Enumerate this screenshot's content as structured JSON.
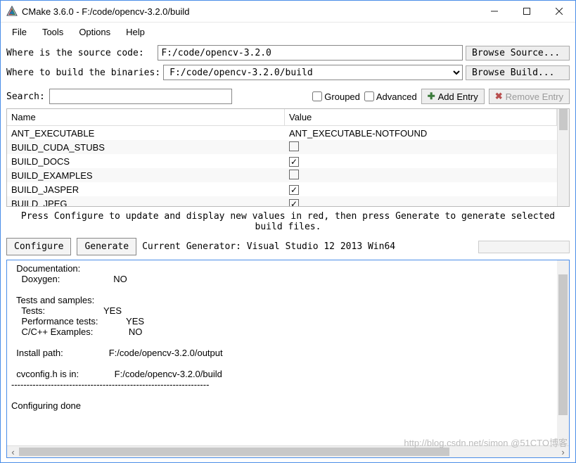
{
  "window": {
    "title": "CMake 3.6.0 - F:/code/opencv-3.2.0/build"
  },
  "menu": {
    "file": "File",
    "tools": "Tools",
    "options": "Options",
    "help": "Help"
  },
  "paths": {
    "source_label": "Where is the source code:  ",
    "source_value": "F:/code/opencv-3.2.0",
    "browse_source": "Browse Source...",
    "build_label": "Where to build the binaries:",
    "build_value": "F:/code/opencv-3.2.0/build",
    "browse_build": "Browse Build..."
  },
  "search": {
    "label": "Search:",
    "value": "",
    "grouped_label": "Grouped",
    "advanced_label": "Advanced",
    "add_entry": "Add Entry",
    "remove_entry": "Remove Entry"
  },
  "table": {
    "header_name": "Name",
    "header_value": "Value",
    "rows": [
      {
        "name": "ANT_EXECUTABLE",
        "value": "ANT_EXECUTABLE-NOTFOUND",
        "type": "text"
      },
      {
        "name": "BUILD_CUDA_STUBS",
        "value": false,
        "type": "bool"
      },
      {
        "name": "BUILD_DOCS",
        "value": true,
        "type": "bool"
      },
      {
        "name": "BUILD_EXAMPLES",
        "value": false,
        "type": "bool"
      },
      {
        "name": "BUILD_JASPER",
        "value": true,
        "type": "bool"
      },
      {
        "name": "BUILD_JPEG",
        "value": true,
        "type": "bool"
      }
    ]
  },
  "hint": "Press Configure to update and display new values in red, then press Generate to generate selected\nbuild files.",
  "actions": {
    "configure": "Configure",
    "generate": "Generate",
    "generator": "Current Generator: Visual Studio 12 2013 Win64"
  },
  "output_lines": [
    "  Documentation:",
    "    Doxygen:                     NO",
    "",
    "  Tests and samples:",
    "    Tests:                       YES",
    "    Performance tests:           YES",
    "    C/C++ Examples:              NO",
    "",
    "  Install path:                  F:/code/opencv-3.2.0/output",
    "",
    "  cvconfig.h is in:              F:/code/opencv-3.2.0/build",
    "-----------------------------------------------------------------",
    "",
    "Configuring done"
  ],
  "watermark": "http://blog.csdn.net/simon @51CTO博客"
}
